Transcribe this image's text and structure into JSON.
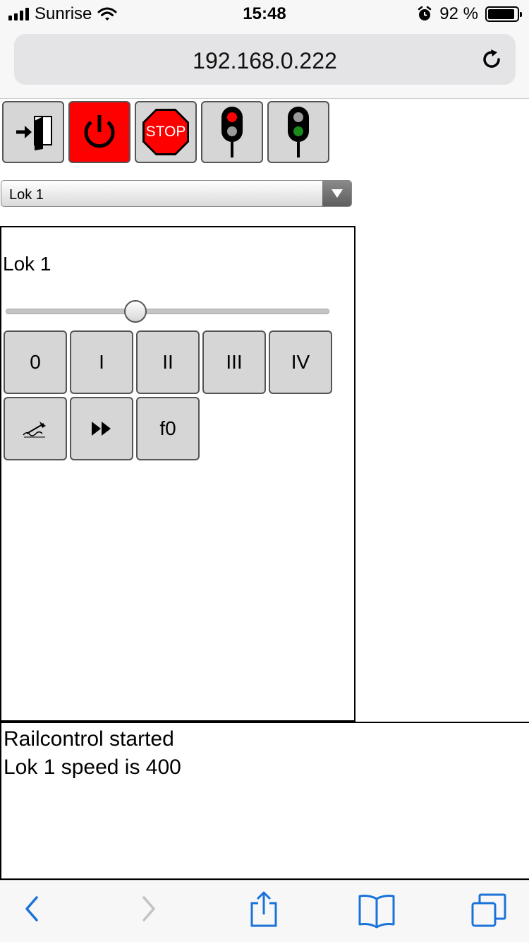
{
  "status_bar": {
    "carrier": "Sunrise",
    "time": "15:48",
    "battery_text": "92 %",
    "battery_level": 0.92
  },
  "browser": {
    "url": "192.168.0.222"
  },
  "toolbar": {
    "stop_label": "STOP"
  },
  "loco_select": {
    "value": "Lok 1"
  },
  "loco_panel": {
    "title": "Lok 1",
    "speed_fraction": 0.4,
    "speed_buttons": [
      "0",
      "I",
      "II",
      "III",
      "IV"
    ],
    "function_label": "f0"
  },
  "log": {
    "lines": [
      "Railcontrol started",
      "Lok 1 speed is 400"
    ]
  },
  "colors": {
    "button_gray": "#d6d6d6",
    "alert_red": "#ff0000",
    "signal_green": "#1a8a1a",
    "ios_blue": "#1a73d9"
  }
}
